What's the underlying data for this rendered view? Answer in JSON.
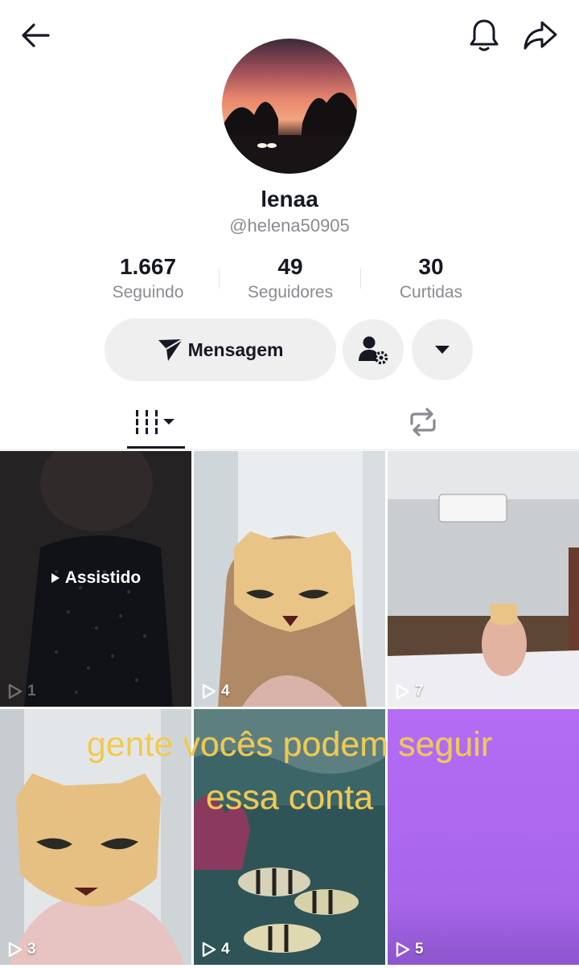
{
  "profile": {
    "name": "lenaa",
    "handle": "@helena50905"
  },
  "stats": [
    {
      "value": "1.667",
      "label": "Seguindo"
    },
    {
      "value": "49",
      "label": "Seguidores"
    },
    {
      "value": "30",
      "label": "Curtidas"
    }
  ],
  "actions": {
    "message_label": "Mensagem"
  },
  "icons": {
    "back": "arrow-left-icon",
    "bell": "bell-icon",
    "share": "share-arrow-icon",
    "send": "paper-plane-icon",
    "user_settings": "user-gear-icon",
    "dropdown": "caret-down-icon",
    "videos_tab": "grid-bars-icon",
    "reposts_tab": "repost-icon"
  },
  "videos": [
    {
      "views": "1",
      "watched_label": "Assistido"
    },
    {
      "views": "4"
    },
    {
      "views": "7"
    },
    {
      "views": "3"
    },
    {
      "views": "4"
    },
    {
      "views": "5"
    }
  ],
  "overlay_caption": {
    "line1": "gente vocês podem seguir",
    "line2": "essa conta"
  },
  "colors": {
    "accent_text": "#161823",
    "secondary_text": "#8a8b91",
    "button_bg": "#efeff0",
    "caption": "#f2c94c"
  }
}
